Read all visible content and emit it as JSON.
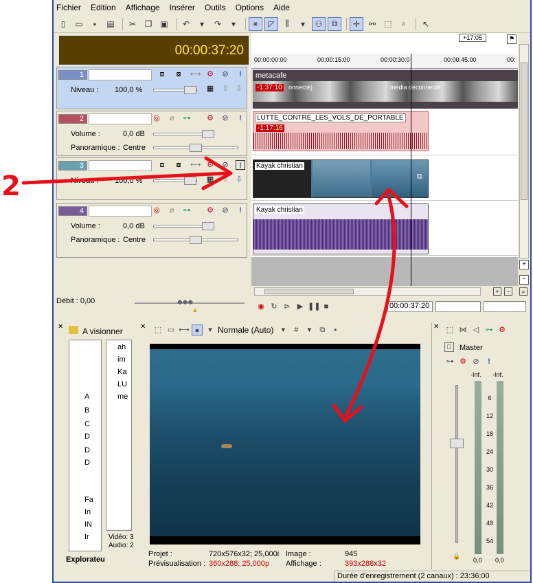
{
  "menu": [
    "Fichier",
    "Edition",
    "Affichage",
    "Insérer",
    "Outils",
    "Options",
    "Aide"
  ],
  "timecode": "00:00:37:20",
  "ruler": {
    "offset": "+17:05",
    "ticks": [
      "00:00:00:00",
      "00:00:15:00",
      "00:00:30:0",
      "00:00:45:00",
      "00:"
    ]
  },
  "tracks": [
    {
      "num": "1",
      "level_label": "Niveau :",
      "level_value": "100,0 %"
    },
    {
      "num": "2",
      "volume_label": "Volume :",
      "volume_value": "0,0 dB",
      "pan_label": "Panoramique :",
      "pan_value": "Centre"
    },
    {
      "num": "3",
      "level_label": "Niveau :",
      "level_value": "100,0 %"
    },
    {
      "num": "4",
      "volume_label": "Volume :",
      "volume_value": "0,0 dB",
      "pan_label": "Panoramique :",
      "pan_value": "Centre"
    }
  ],
  "clips": {
    "c1_name": "metacafe",
    "c1_time": "-1:37:10",
    "c1_note": "onnecté)",
    "c1_note2": "média déconnecté",
    "c2_name": "LUTTE_CONTRE_LES_VOLS_DE_PORTABLE",
    "c2_time": "-1:17:16",
    "c3_name": "Kayak christian",
    "c4_name": "Kayak christian"
  },
  "debit": "Débit : 0,00",
  "transport_time": "00:00:37:20",
  "explorer": {
    "tab_label": "A visionner",
    "tree": [
      "A",
      "B",
      "C",
      "D",
      "D",
      "D",
      "Fa",
      "In",
      "IN",
      "Ir"
    ],
    "files": [
      "ah",
      "im",
      "Ka",
      "LU",
      "me"
    ],
    "info_video": "Vidéo: 3",
    "info_audio": "Audio: 2",
    "bottom_tab": "Explorateu"
  },
  "preview": {
    "mode": "Normale (Auto)",
    "projet_label": "Projet :",
    "projet_value": "720x576x32; 25,000i",
    "preview_label": "Prévisualisation :",
    "preview_value": "360x288; 25,000p",
    "image_label": "Image :",
    "image_value": "945",
    "affichage_label": "Affichage :",
    "affichage_value": "393x288x32"
  },
  "mixer": {
    "master": "Master",
    "inf_l": "-Inf.",
    "inf_r": "-Inf.",
    "scale": [
      "6",
      "12",
      "18",
      "24",
      "30",
      "36",
      "42",
      "48",
      "54"
    ],
    "val_l": "0,0",
    "val_r": "0,0"
  },
  "status": "Durée d'enregistrement (2 canaux) : 23:36:00",
  "annotation": "2",
  "colors": {
    "accent": "#2a4aa8",
    "timecode_bg": "#5a4000",
    "timecode_fg": "#ffe54a",
    "annot": "#e8101a"
  }
}
